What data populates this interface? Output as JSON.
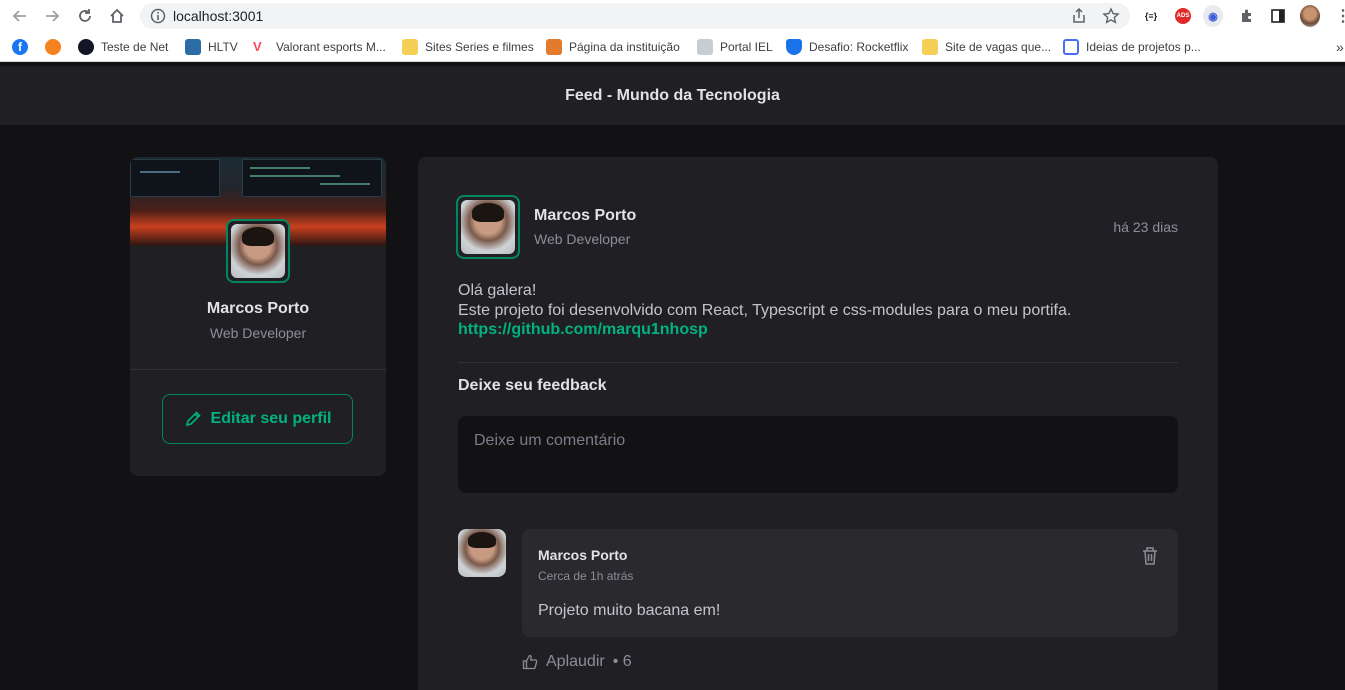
{
  "browser": {
    "url": "localhost:3001",
    "bookmarks": [
      {
        "label": "",
        "color": "#1877f2"
      },
      {
        "label": "",
        "color": "#f58220"
      },
      {
        "label": "Teste de Net",
        "color": "#141526"
      },
      {
        "label": "HLTV",
        "color": "#2b6ea6"
      },
      {
        "label": "Valorant esports M...",
        "color": "#ff4655"
      },
      {
        "label": "Sites Series e filmes",
        "color": "#f6cf57"
      },
      {
        "label": "Página da instituição",
        "color": "#e37b2c"
      },
      {
        "label": "Portal IEL",
        "color": "#9aa0a6"
      },
      {
        "label": "Desafio: Rocketflix",
        "color": "#1a73e8"
      },
      {
        "label": "Site de vagas que...",
        "color": "#f6cf57"
      },
      {
        "label": "Ideias de projetos p...",
        "color": "#4a6cf7"
      }
    ],
    "overflow": "»"
  },
  "header": {
    "title": "Feed - Mundo da Tecnologia"
  },
  "sidebar": {
    "name": "Marcos Porto",
    "role": "Web Developer",
    "edit_label": "Editar seu perfil"
  },
  "post": {
    "author": "Marcos Porto",
    "role": "Web Developer",
    "time": "há 23 dias",
    "lines": [
      "Olá galera!",
      "Este projeto foi desenvolvido com React, Typescript e css-modules para o meu portifa."
    ],
    "link": "https://github.com/marqu1nhosp",
    "feedback_title": "Deixe seu feedback",
    "feedback_placeholder": "Deixe um comentário"
  },
  "comment": {
    "author": "Marcos Porto",
    "time": "Cerca de 1h atrás",
    "text": "Projeto muito bacana em!",
    "applaud_label": "Aplaudir",
    "applaud_count": "• 6"
  },
  "colors": {
    "accent": "#00875f",
    "accent_light": "#00b37e",
    "bg": "#121214",
    "card": "#202024"
  }
}
